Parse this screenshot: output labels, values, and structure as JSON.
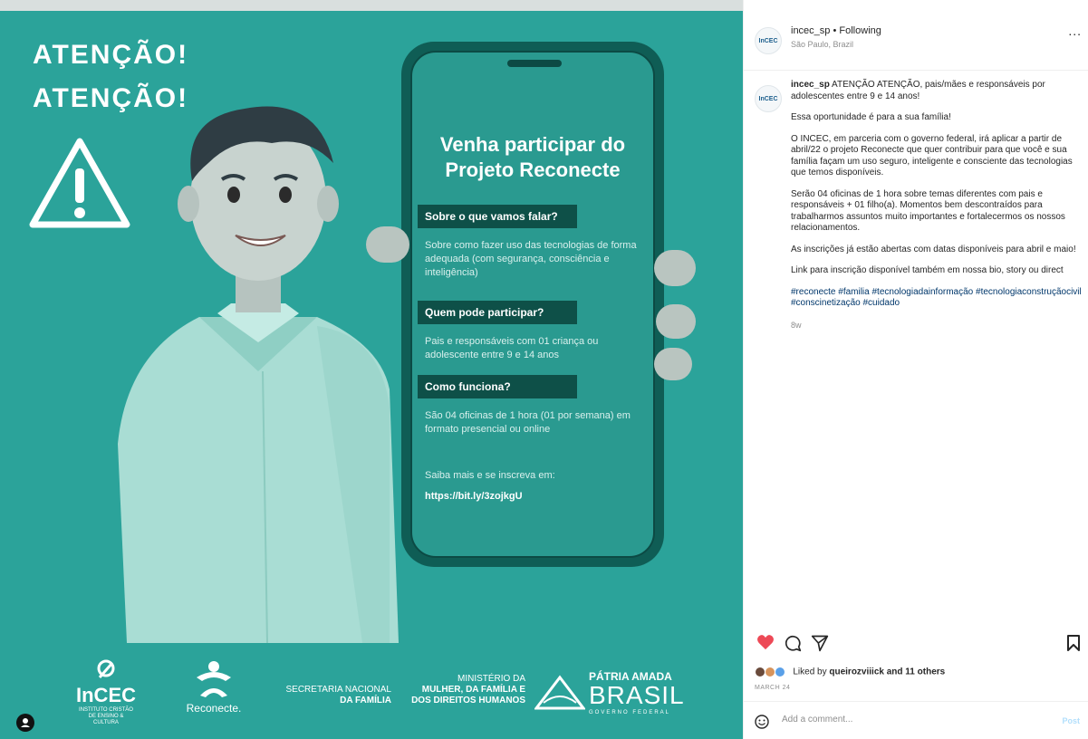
{
  "poster": {
    "attention_line1": "ATENÇÃO!",
    "attention_line2": "ATENÇÃO!",
    "phone_title": "Venha participar do Projeto Reconecte",
    "sections": [
      {
        "heading": "Sobre o que vamos falar?",
        "text": "Sobre como fazer uso das tecnologias de forma adequada (com segurança, consciência e inteligência)"
      },
      {
        "heading": "Quem pode participar?",
        "text": "Pais e responsáveis com 01 criança ou adolescente entre 9 e 14 anos"
      },
      {
        "heading": "Como funciona?",
        "text": "São 04 oficinas de 1 hora (01 por semana) em formato presencial ou online"
      }
    ],
    "cta": "Saiba mais e se inscreva em:",
    "link": "https://bit.ly/3zojkgU",
    "logos": {
      "incec_name": "InCEC",
      "incec_sub": "INSTITUTO CRISTÃO DE ENSINO & CULTURA",
      "reconecte": "Reconecte.",
      "sec_line1": "SECRETARIA NACIONAL",
      "sec_line2": "DA FAMÍLIA",
      "min_line1": "MINISTÉRIO DA",
      "min_line2": "MULHER, DA FAMÍLIA E",
      "min_line3": "DOS DIREITOS HUMANOS",
      "brasil_top": "PÁTRIA AMADA",
      "brasil": "BRASIL",
      "brasil_gov": "GOVERNO FEDERAL"
    },
    "bg_color": "#2ba39a"
  },
  "header": {
    "avatar_text": "InCEC",
    "username": "incec_sp",
    "separator": "•",
    "follow_label": "Following",
    "location": "São Paulo, Brazil",
    "more": "..."
  },
  "caption": {
    "username": "incec_sp",
    "first": "ATENÇÃO ATENÇÃO, pais/mães e responsáveis por adolescentes entre 9 e 14 anos!",
    "p1": "Essa oportunidade é para a sua família!",
    "p2": "O INCEC, em parceria com o governo federal, irá aplicar a partir de abril/22 o projeto Reconecte que quer contribuir para que você e sua família façam um uso seguro, inteligente e consciente das tecnologias que temos disponíveis.",
    "p3": "Serão 04 oficinas de 1 hora sobre temas diferentes com pais e responsáveis + 01 filho(a). Momentos bem descontraídos para trabalharmos assuntos muito importantes e fortalecermos os nossos relacionamentos.",
    "p4": "As inscrições já estão abertas com datas disponíveis para abril e maio!",
    "p5": "Link para inscrição disponível também em nossa bio, story ou direct",
    "tags": "#reconecte #familia #tecnologiadainformação #tecnologiaconstruçãocivil #conscinetização #cuidado",
    "age": "8w"
  },
  "engagement": {
    "liked_by_prefix": "Liked by",
    "liked_user": "queirozviiick",
    "liked_suffix": "and 11 others",
    "date": "MARCH 24"
  },
  "comment": {
    "placeholder": "Add a comment...",
    "post_label": "Post"
  },
  "colors": {
    "like": "#ed4956",
    "tag": "#00376b",
    "accent": "#2ba39a"
  }
}
